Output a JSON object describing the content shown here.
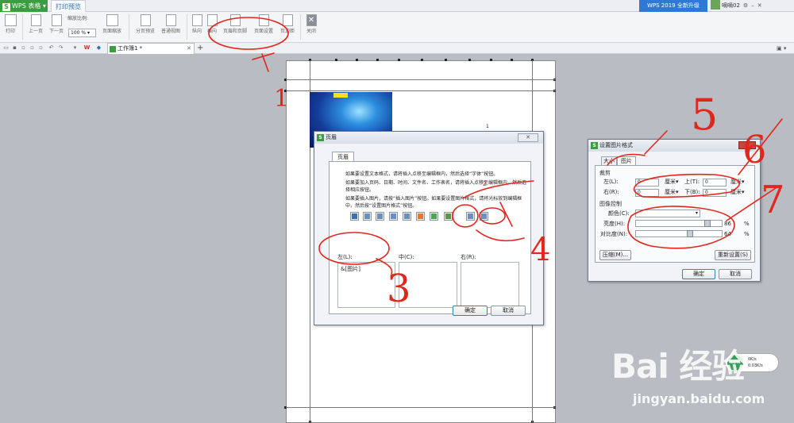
{
  "titlebar": {
    "app_name": "WPS 表格",
    "tab_label": "打印预览",
    "upgrade_label": "WPS 2019 全新升级",
    "user_name": "嘀嘀02"
  },
  "toolbar": {
    "print": "打印",
    "prev_page": "上一页",
    "next_page": "下一页",
    "zoom_label": "缩放比例:",
    "zoom_value": "100 %",
    "page_scale": "页面缩放",
    "page_break_preview": "分页预览",
    "normal_view": "普通视图",
    "portrait": "纵向",
    "landscape": "横向",
    "header_footer": "页眉和页脚",
    "page_setup": "页面设置",
    "margins": "页边距",
    "close": "关闭"
  },
  "tabbar": {
    "doc_tab": "工作簿1 *"
  },
  "page": {
    "page_number": "1"
  },
  "header_dialog": {
    "title": "页眉",
    "tab": "页眉",
    "para1": "如果要设置文本格式，请将插入点移至编辑框内，然后选择“字体”按钮。",
    "para2": "如果要加入页码、日期、时间、文件名、工作表名，请将插入点移至编辑框内，然后选择相应按钮。",
    "para3": "如果要插入图片，请按“插入图片”按钮。如果要设置图片格式，请将光标放到编辑框中，然后按“设置图片格式”按钮。",
    "left_label": "左(L):",
    "center_label": "中(C):",
    "right_label": "右(R):",
    "left_content": "&[图片]",
    "ok": "确定",
    "cancel": "取消"
  },
  "image_dialog": {
    "title": "设置图片格式",
    "tab_size": "大小",
    "tab_picture": "图片",
    "crop_section": "裁剪",
    "left_label": "左(L):",
    "right_label": "右(R):",
    "top_label": "上(T):",
    "bottom_label": "下(B):",
    "left_value": "0",
    "right_value": "0",
    "top_value": "0",
    "bottom_value": "0",
    "unit": "厘米▾",
    "image_control": "图像控制",
    "color_label": "颜色(C):",
    "brightness_label": "亮度(H):",
    "contrast_label": "对比度(N):",
    "brightness_value": "86",
    "contrast_value": "64",
    "percent": "%",
    "compress": "压缩(M)...",
    "reset": "重新设置(S)",
    "ok": "确定",
    "cancel": "取消"
  },
  "annotations": [
    "1",
    "2",
    "3",
    "4",
    "5",
    "6",
    "7"
  ],
  "watermark": {
    "text": "Bai 经验",
    "url": "jingyan.baidu.com"
  },
  "net_widget": {
    "percent": "63%",
    "down": "0K/s",
    "up": "0.03K/s"
  }
}
